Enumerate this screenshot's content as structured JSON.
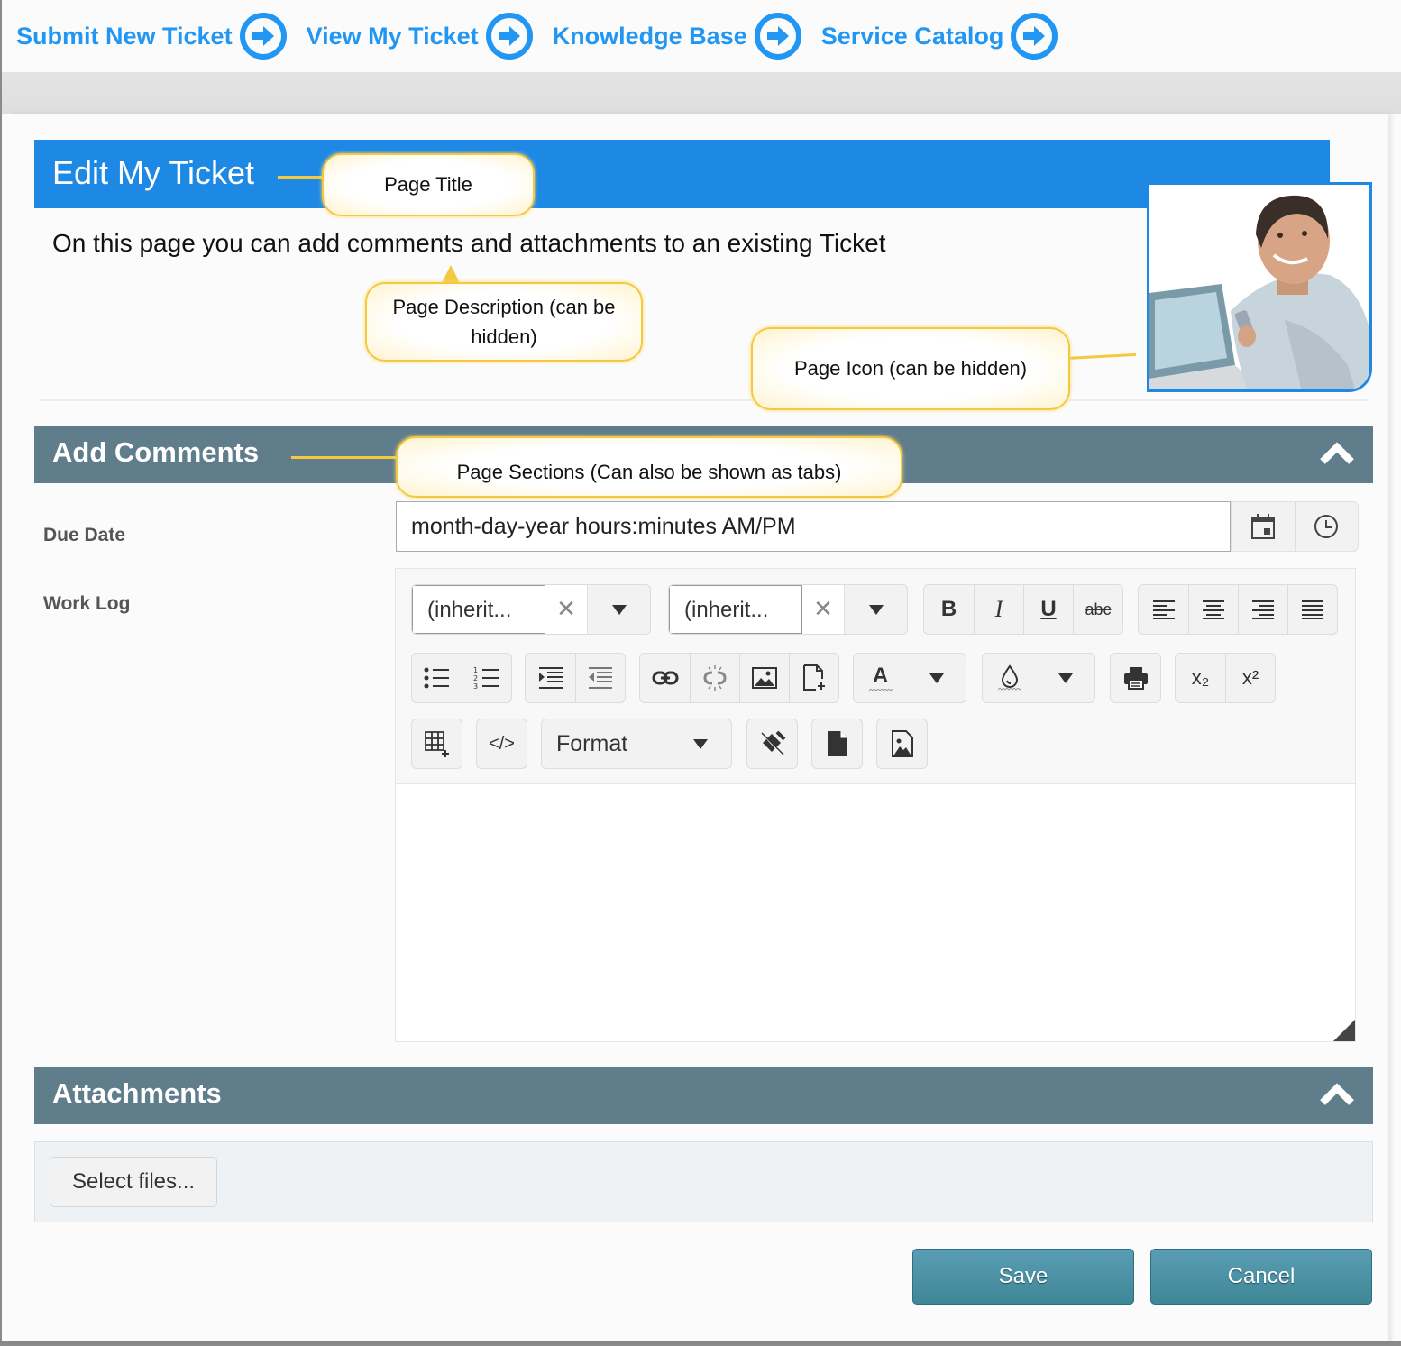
{
  "topnav": {
    "links": [
      {
        "label": "Submit New Ticket",
        "icon": "arrow-circle-right-icon"
      },
      {
        "label": "View My Ticket",
        "icon": "arrow-circle-right-icon"
      },
      {
        "label": "Knowledge Base",
        "icon": "arrow-circle-right-icon"
      },
      {
        "label": "Service Catalog",
        "icon": "arrow-circle-right-icon"
      }
    ]
  },
  "page": {
    "title": "Edit My Ticket",
    "description": "On this page you can add comments and attachments to an existing Ticket",
    "icon": "user-photo-icon"
  },
  "callouts": {
    "page_title": "Page Title",
    "page_description": "Page Description (can be hidden)",
    "page_icon": "Page Icon (can be hidden)",
    "page_sections": "Page Sections (Can also be shown as tabs)"
  },
  "sections": {
    "add_comments": {
      "title": "Add Comments",
      "collapse_icon": "chevron-up-icon",
      "fields": {
        "due_date": {
          "label": "Due Date",
          "placeholder": "month-day-year hours:minutes AM/PM",
          "calendar_icon": "calendar-icon",
          "clock_icon": "clock-icon"
        },
        "work_log": {
          "label": "Work Log",
          "toolbar": {
            "font_name": "(inherit...",
            "font_size": "(inherit...",
            "clear_symbol": "✕",
            "bold": "B",
            "italic": "I",
            "underline": "U",
            "strikethrough": "abc",
            "font_color_glyph": "A",
            "subscript": "x₂",
            "superscript": "x²",
            "format_label": "Format",
            "view_html": "</>"
          }
        }
      }
    },
    "attachments": {
      "title": "Attachments",
      "collapse_icon": "chevron-up-icon",
      "select_files_label": "Select files..."
    }
  },
  "actions": {
    "save_label": "Save",
    "cancel_label": "Cancel"
  },
  "colors": {
    "brand_blue": "#1e88e5",
    "nav_link": "#2196f3",
    "section_header": "#607d8b",
    "button_teal": "#4a8fa3",
    "callout_border": "#f5c842"
  }
}
